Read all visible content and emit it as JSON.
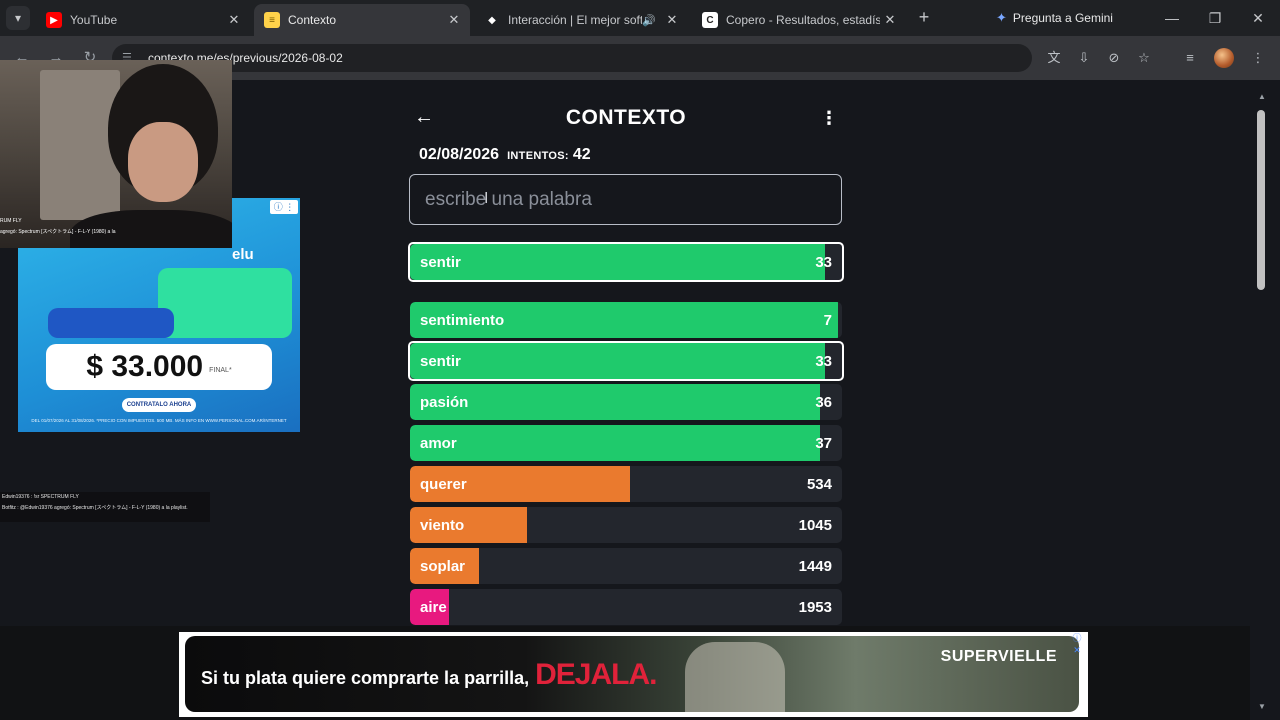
{
  "tabs": [
    {
      "title": "YouTube",
      "favicon": "youtube-icon",
      "color": "#ff0000",
      "active": false
    },
    {
      "title": "Contexto",
      "favicon": "contexto-icon",
      "color": "#ffd24a",
      "active": true
    },
    {
      "title": "Interacción | El mejor softw",
      "favicon": "interaccion-icon",
      "color": "#ffffff",
      "active": false
    },
    {
      "title": "Copero - Resultados, estadístic",
      "favicon": "copero-icon",
      "color": "#ffffff",
      "active": false
    }
  ],
  "gemini_label": "Pregunta a Gemini",
  "url": "contexto.me/es/previous/2026-08-02",
  "game": {
    "title": "CONTEXTO",
    "date": "02/08/2026",
    "attempts_label": "INTENTOS:",
    "attempts": "42",
    "input_placeholder": "escribe una palabra",
    "last_guess": {
      "word": "sentir",
      "rank": "33",
      "fill_percent": 96,
      "color": "#1fca6c"
    },
    "guesses": [
      {
        "word": "sentimiento",
        "rank": "7",
        "fill_percent": 99,
        "color": "#1fca6c",
        "highlight": false
      },
      {
        "word": "sentir",
        "rank": "33",
        "fill_percent": 96,
        "color": "#1fca6c",
        "highlight": true
      },
      {
        "word": "pasión",
        "rank": "36",
        "fill_percent": 95,
        "color": "#1fca6c",
        "highlight": false
      },
      {
        "word": "amor",
        "rank": "37",
        "fill_percent": 95,
        "color": "#1fca6c",
        "highlight": false
      },
      {
        "word": "querer",
        "rank": "534",
        "fill_percent": 51,
        "color": "#ea7a2e",
        "highlight": false
      },
      {
        "word": "viento",
        "rank": "1045",
        "fill_percent": 27,
        "color": "#ea7a2e",
        "highlight": false
      },
      {
        "word": "soplar",
        "rank": "1449",
        "fill_percent": 16,
        "color": "#ea7a2e",
        "highlight": false
      },
      {
        "word": "aire",
        "rank": "1953",
        "fill_percent": 9,
        "color": "#e8197f",
        "highlight": false
      }
    ]
  },
  "ad_left": {
    "brand_text": "elu",
    "price": "$ 33.000",
    "price_note": "FINAL*",
    "cta": "CONTRATALO AHORA",
    "fine_print": "DEL 01/07/2026 AL 31/08/2026. *PRECIO CON IMPUESTOS. 500 MB. MÁS INFO EN WWW.PERSONAL.COM.AR/INTERNET"
  },
  "webcam": {
    "overlay_line1": "RUM FLY",
    "overlay_line2": "agregó: Spectrum [スペクトラム] - F-L-Y (1980) a la"
  },
  "chat": [
    "Edwin19376 : !sr SPECTRUM FLY",
    "Botfitz : @Edwin19376 agregó: Spectrum [スペクトラム] - F-L-Y (1980) a la playlist."
  ],
  "ad_bottom": {
    "copy": "Si tu plata quiere comprarte la parrilla,",
    "accent": "DEJALA.",
    "brand": "SUPERVIELLE"
  }
}
